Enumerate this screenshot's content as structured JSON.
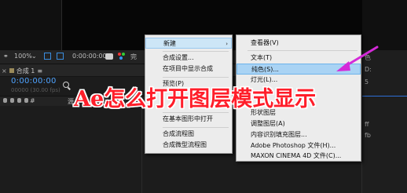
{
  "toolbar": {
    "zoom": "100%",
    "time": "0:00:00:00",
    "quality_fragment": "完"
  },
  "timeline": {
    "tab_label": "合成 1",
    "tab_close": "≡",
    "timecode": "0:00:00:00",
    "fps": "00000 (30.00 fps)",
    "header_fragment": "#",
    "header_name": "源"
  },
  "context_menu": {
    "items": [
      {
        "label": "新建",
        "has_submenu": true,
        "arrow": "›"
      },
      {
        "label": "合成设置..."
      },
      {
        "label": "在项目中显示合成"
      },
      {
        "label": "预览(P)"
      },
      {
        "label": "在基本图形中打开"
      },
      {
        "label": "合成流程图"
      },
      {
        "label": "合成微型流程图"
      }
    ]
  },
  "submenu": {
    "items": [
      {
        "label": "查看器(V)"
      },
      {
        "label": "文本(T)"
      },
      {
        "label": "纯色(S)..."
      },
      {
        "label": "灯光(L)..."
      },
      {
        "label": "形状图层"
      },
      {
        "label": "调整图层(A)"
      },
      {
        "label": "内容识别填充图层..."
      },
      {
        "label": "Adobe Photoshop 文件(H)..."
      },
      {
        "label": "MAXON CINEMA 4D 文件(C)..."
      }
    ]
  },
  "right_panel": {
    "labels": [
      "色",
      "D:",
      "5",
      "ff",
      "fb"
    ]
  },
  "overlay": {
    "title": "Ae怎么打开图层模式显示",
    "arrow_color": "#d42ad8"
  },
  "colors": {
    "menu_bg": "#ececec",
    "menu_highlight": "#a9d3f4",
    "timecode_blue": "#4fa3ff",
    "title_red": "#ff1e2a"
  }
}
